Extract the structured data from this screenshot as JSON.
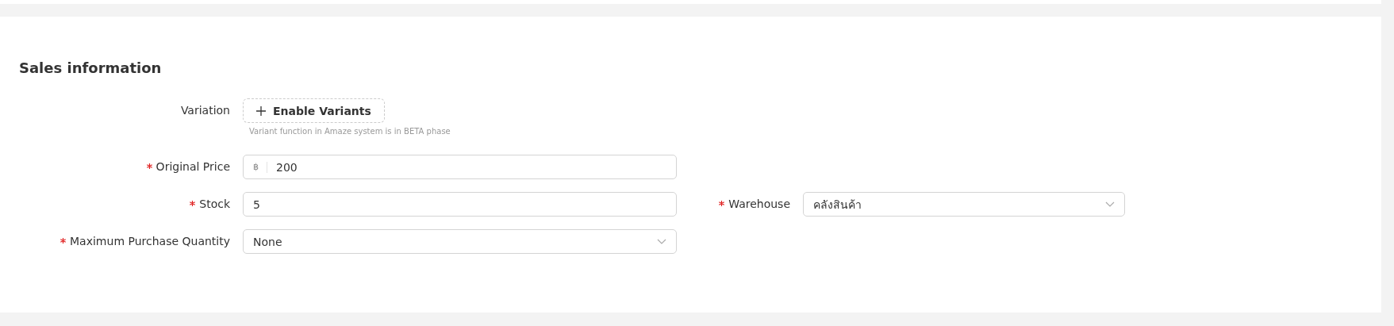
{
  "section": {
    "title": "Sales information",
    "rows": [
      {
        "fields": [
          {
            "kind": "button",
            "label": "Variation",
            "required": false,
            "value": "Enable Variants",
            "hint": "Variant function in Amaze system is in BETA phase"
          }
        ]
      },
      {
        "fields": [
          {
            "kind": "text",
            "label": "Original Price",
            "required": true,
            "prefix": "฿",
            "value": "200"
          }
        ]
      },
      {
        "fields": [
          {
            "kind": "text",
            "label": "Stock",
            "required": true,
            "value": "5"
          },
          {
            "kind": "select",
            "label": "Warehouse",
            "required": true,
            "value": "คลังสินค้า"
          }
        ]
      },
      {
        "fields": [
          {
            "kind": "select",
            "label": "Maximum Purchase Quantity",
            "required": true,
            "value": "None"
          }
        ]
      }
    ]
  }
}
